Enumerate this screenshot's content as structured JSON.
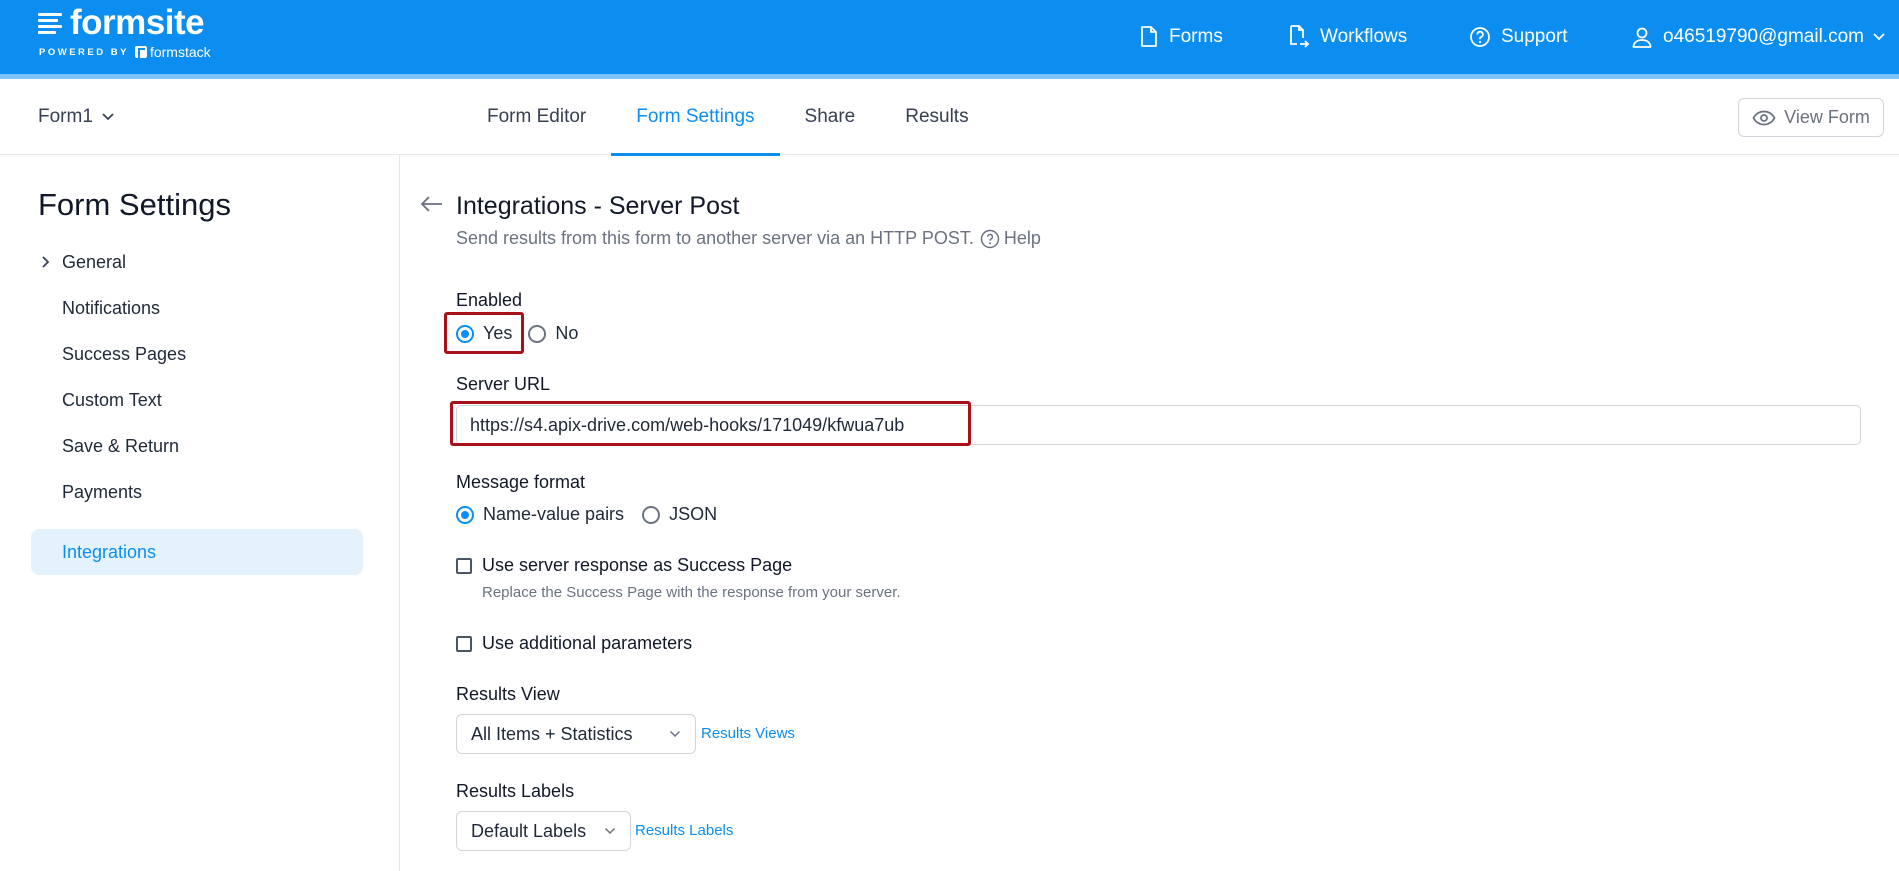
{
  "brand": {
    "name": "formsite",
    "powered_by": "POWERED BY",
    "partner": "formstack",
    "color": "#0b8ef0"
  },
  "topnav": {
    "forms": "Forms",
    "workflows": "Workflows",
    "support": "Support",
    "user": "o46519790@gmail.com"
  },
  "subheader": {
    "form_name": "Form1",
    "tabs": [
      "Form Editor",
      "Form Settings",
      "Share",
      "Results"
    ],
    "active_tab": "Form Settings",
    "view_form": "View Form"
  },
  "sidebar": {
    "title": "Form Settings",
    "items": [
      {
        "label": "General"
      },
      {
        "label": "Notifications"
      },
      {
        "label": "Success Pages"
      },
      {
        "label": "Custom Text"
      },
      {
        "label": "Save & Return"
      },
      {
        "label": "Payments"
      },
      {
        "label": "Integrations"
      }
    ],
    "active_item": "Integrations"
  },
  "main": {
    "title": "Integrations - Server Post",
    "description": "Send results from this form to another server via an HTTP POST.",
    "help": "Help",
    "enabled": {
      "label": "Enabled",
      "yes": "Yes",
      "no": "No",
      "selected": "Yes"
    },
    "server_url": {
      "label": "Server URL",
      "value": "https://s4.apix-drive.com/web-hooks/171049/kfwua7ub"
    },
    "message_format": {
      "label": "Message format",
      "option_pairs": "Name-value pairs",
      "option_json": "JSON",
      "selected": "Name-value pairs"
    },
    "use_server_response": {
      "label": "Use server response as Success Page",
      "help": "Replace the Success Page with the response from your server.",
      "checked": false
    },
    "use_additional_params": {
      "label": "Use additional parameters",
      "checked": false
    },
    "results_view": {
      "label": "Results View",
      "value": "All Items + Statistics",
      "link": "Results Views"
    },
    "results_labels": {
      "label": "Results Labels",
      "value": "Default Labels",
      "link": "Results Labels"
    }
  },
  "colors": {
    "highlight": "#a8101a",
    "active_bg": "#e4f2fd"
  }
}
